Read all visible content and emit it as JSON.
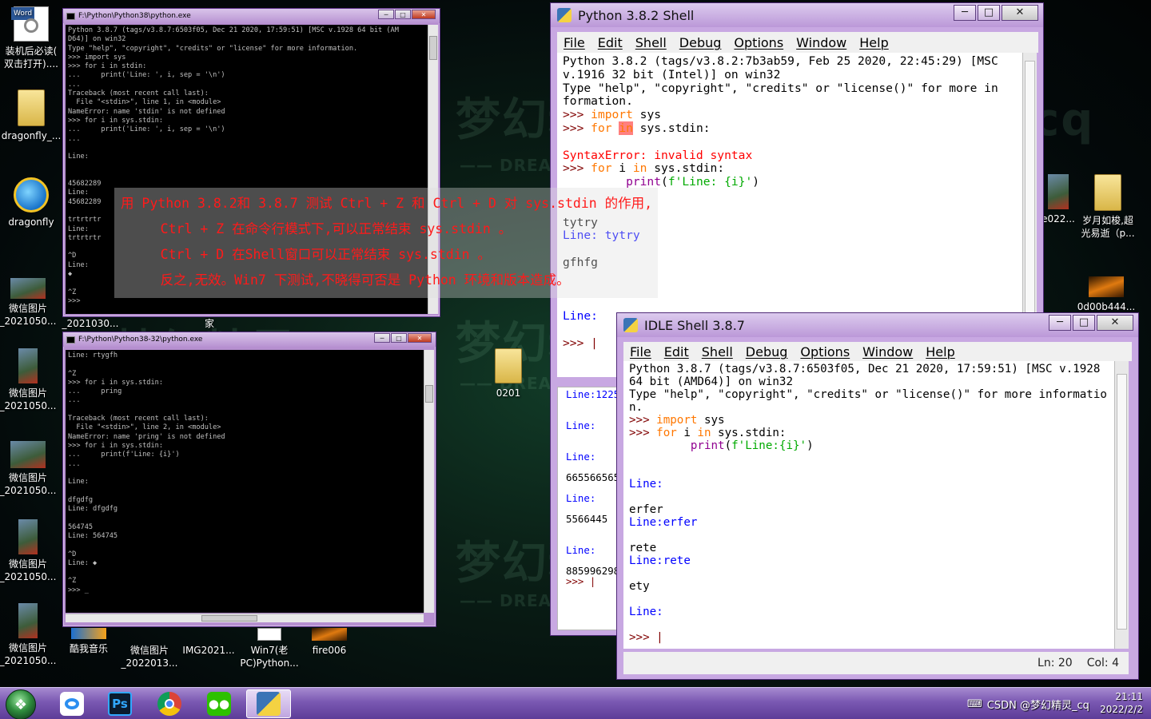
{
  "watermark": {
    "cn": "梦幻精灵_cq",
    "en": "—— DREAM SPIRIT_ CQ"
  },
  "desktop_icons": [
    {
      "name": "word-doc-icon",
      "label": "装机后必读(\n双击打开)....",
      "badge": "Word",
      "kind": "doc"
    },
    {
      "name": "folder-icon",
      "label": "dragonfly_...",
      "kind": "folder"
    },
    {
      "name": "ie-icon",
      "label": "dragonfly",
      "kind": "ie"
    },
    {
      "name": "photo-icon",
      "label": "微信图片\n_2021050...",
      "kind": "photo"
    },
    {
      "name": "photo-icon",
      "label": "微信图片\n_2021050...",
      "kind": "photo"
    },
    {
      "name": "photo-icon",
      "label": "微信图片\n_2021050...",
      "kind": "photo"
    },
    {
      "name": "photo-icon",
      "label": "微信图片\n_2021050...",
      "kind": "photo"
    },
    {
      "name": "photo-icon",
      "label": "微信图片\n_2021050...",
      "kind": "photo"
    },
    {
      "name": "photo-icon",
      "label": "_2021030...",
      "kind": "none"
    },
    {
      "name": "folder-icon",
      "label": "家",
      "kind": "none"
    },
    {
      "name": "folder-icon",
      "label": "0201",
      "kind": "folder"
    },
    {
      "name": "music-icon",
      "label": "酷我音乐",
      "kind": "none"
    },
    {
      "name": "photo-icon",
      "label": "微信图片\n_2022013...",
      "kind": "none"
    },
    {
      "name": "photo-icon",
      "label": "IMG2021...",
      "kind": "none"
    },
    {
      "name": "doc-icon",
      "label": "Win7(老\nPC)Python...",
      "kind": "doc2"
    },
    {
      "name": "fire-icon",
      "label": "fire006",
      "kind": "fire"
    },
    {
      "name": "photo-icon",
      "label": "e022...",
      "kind": "photo"
    },
    {
      "name": "folder-icon",
      "label": "岁月如梭,超\n光易逝（p...",
      "kind": "folder"
    },
    {
      "name": "fire-icon",
      "label": "0d00b444...",
      "kind": "fire"
    }
  ],
  "cmd1": {
    "title": "F:\\Python\\Python38\\python.exe",
    "lines": "Python 3.8.7 (tags/v3.8.7:6503f05, Dec 21 2020, 17:59:51) [MSC v.1928 64 bit (AM\nD64)] on win32\nType \"help\", \"copyright\", \"credits\" or \"license\" for more information.\n>>> import sys\n>>> for i in stdin:\n...     print('Line: ', i, sep = '\\n')\n...\nTraceback (most recent call last):\n  File \"<stdin>\", line 1, in <module>\nNameError: name 'stdin' is not defined\n>>> for i in sys.stdin:\n...     print('Line: ', i, sep = '\\n')\n...\n\nLine:\n\n\n45682289\nLine:\n45682289\n\ntrtrtrtr\nLine:\ntrtrtrtr\n\n^D\nLine:\n◆\n\n^Z\n>>>"
  },
  "cmd2": {
    "title": "F:\\Python\\Python38-32\\python.exe",
    "lines": "Line: rtygfh\n\n^Z\n>>> for i in sys.stdin:\n...     pring\n...\n\nTraceback (most recent call last):\n  File \"<stdin>\", line 2, in <module>\nNameError: name 'pring' is not defined\n>>> for i in sys.stdin:\n...     print(f'Line: {i}')\n...\n\nLine:\n\ndfgdfg\nLine: dfgdfg\n\n564745\nLine: 564745\n\n^D\nLine: ◆\n\n^Z\n>>> _"
  },
  "idle382": {
    "title": "Python 3.8.2 Shell",
    "menu": [
      "File",
      "Edit",
      "Shell",
      "Debug",
      "Options",
      "Window",
      "Help"
    ],
    "banner1": "Python 3.8.2 (tags/v3.8.2:7b3ab59, Feb 25 2020, 22:45:29) [MSC",
    "banner2": "v.1916 32 bit (Intel)] on win32",
    "banner3": "Type \"help\", \"copyright\", \"credits\" or \"license()\" for more in",
    "banner4": "formation.",
    "prompt": ">>> ",
    "kw_import": "import",
    "kw_for": "for",
    "kw_in": "in",
    "mod_sys": " sys",
    "for_rest": " sys.stdin:",
    "err": "SyntaxError: invalid syntax",
    "for2_i": " i ",
    "for2_rest": " sys.stdin:",
    "print_fn": "print",
    "print_open": "(",
    "print_str": "f'Line: {i}'",
    "print_close": ")",
    "in1": "tytry",
    "out1": "Line: tytry",
    "in2": "gfhfg",
    "out2": "Line:",
    "final": ">>> |",
    "behind": [
      "Line:1225",
      "Line:",
      "Line:",
      "665566565",
      "Line:",
      "5566445",
      "Line:",
      "885996298",
      ">>> |"
    ]
  },
  "idle387": {
    "title": "IDLE Shell 3.8.7",
    "menu": [
      "File",
      "Edit",
      "Shell",
      "Debug",
      "Options",
      "Window",
      "Help"
    ],
    "banner1": "Python 3.8.7 (tags/v3.8.7:6503f05, Dec 21 2020, 17:59:51) [MSC v.1928",
    "banner2": "64 bit (AMD64)] on win32",
    "banner3": "Type \"help\", \"copyright\", \"credits\" or \"license()\" for more informatio",
    "banner4": "n.",
    "prompt": ">>> ",
    "kw_import": "import",
    "mod_sys": " sys",
    "kw_for": "for",
    "for_i": " i ",
    "kw_in": "in",
    "for_rest": " sys.stdin:",
    "print_fn": "print",
    "print_open": "(",
    "print_str": "f'Line:{i}'",
    "print_close": ")",
    "out0": "Line:",
    "in1": "erfer",
    "out1": "Line:erfer",
    "in2": "rete",
    "out2": "Line:rete",
    "in3": "ety",
    "out3": "Line:",
    "final": ">>> |",
    "status_ln": "Ln: 20",
    "status_col": "Col: 4"
  },
  "overlay": {
    "line1": "用 Python 3.8.2和 3.8.7 测试 Ctrl + Z 和 Ctrl + D 对 sys.stdin 的作用,",
    "line2": "     Ctrl + Z 在命令行模式下,可以正常结束 sys.stdin 。",
    "line3": "     Ctrl + D 在Shell窗口可以正常结束 sys.stdin 。",
    "line4": "     反之,无效。Win7 下测试,不晓得可否是 Python 环境和版本造成。"
  },
  "taskbar": {
    "start": "start-orb",
    "apps": [
      "baidu-netdisk",
      "photoshop",
      "chrome",
      "wechat",
      "python-idle"
    ],
    "ps_label": "Ps",
    "tray_text": "CSDN @梦幻精灵_cq",
    "time": "21:11",
    "date": "2022/2/2"
  }
}
